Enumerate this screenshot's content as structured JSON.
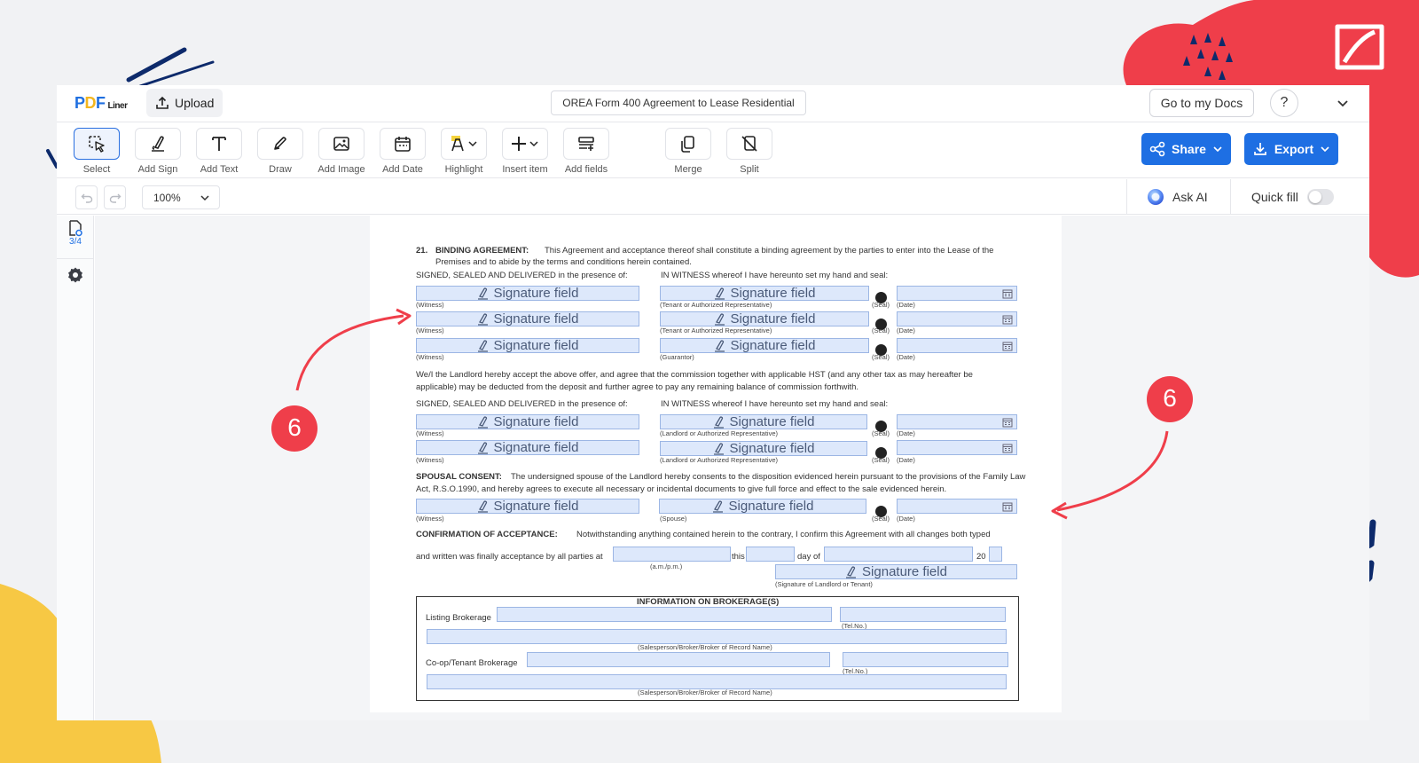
{
  "header": {
    "logo": {
      "p1": "P",
      "p2": "D",
      "p3": "F",
      "sub": "Liner"
    },
    "upload_label": "Upload",
    "doc_title": "OREA Form 400 Agreement to Lease Residential",
    "go_to_docs_label": "Go to my Docs",
    "help_label": "?"
  },
  "toolbar": {
    "tools": [
      {
        "label": "Select",
        "icon": "select-icon"
      },
      {
        "label": "Add Sign",
        "icon": "pen-sign-icon"
      },
      {
        "label": "Add Text",
        "icon": "text-icon"
      },
      {
        "label": "Draw",
        "icon": "draw-icon"
      },
      {
        "label": "Add Image",
        "icon": "image-icon"
      },
      {
        "label": "Add Date",
        "icon": "calendar-icon"
      },
      {
        "label": "Highlight",
        "icon": "highlight-icon"
      },
      {
        "label": "Insert item",
        "icon": "plus-icon"
      },
      {
        "label": "Add fields",
        "icon": "fields-icon"
      },
      {
        "label": "Merge",
        "icon": "merge-icon"
      },
      {
        "label": "Split",
        "icon": "split-icon"
      }
    ],
    "share_label": "Share",
    "export_label": "Export"
  },
  "subbar": {
    "zoom": "100%",
    "ask_ai_label": "Ask AI",
    "quick_fill_label": "Quick fill",
    "quick_fill_on": false
  },
  "sidebar": {
    "page_indicator": "3/4"
  },
  "colors": {
    "accent": "#1e6fe3",
    "field_fill": "#dde8fb",
    "annotation": "#ef3e4a",
    "deco_yellow": "#f7c844",
    "deco_navy": "#0d2a6b"
  },
  "annotations": {
    "left_badge": "6",
    "right_badge": "6"
  },
  "document": {
    "s21_num": "21.",
    "s21_title": "BINDING AGREEMENT:",
    "s21_text1": "This Agreement and acceptance thereof shall constitute a binding agreement by the parties to enter into the Lease of the",
    "s21_text2": "Premises and to abide by the terms and conditions herein contained.",
    "signed_sealed": "SIGNED, SEALED AND DELIVERED in the presence of:",
    "in_witness": "IN WITNESS whereof I have hereunto set my hand and seal:",
    "signature_field": "Signature field",
    "witness_label": "(Witness)",
    "tenant_rep_label": "(Tenant or Authorized Representative)",
    "guarantor_label": "(Guarantor)",
    "landlord_rep_label": "(Landlord or Authorized Representative)",
    "spouse_label": "(Spouse)",
    "seal_label": "(Seal)",
    "date_label": "(Date)",
    "landlord_text1": "We/I the Landlord hereby accept the above offer, and agree that the commission together with applicable HST (and any other tax as may hereafter be",
    "landlord_text2": "applicable) may be deducted from the deposit and further agree to pay any remaining balance of commission forthwith.",
    "spousal_title": "SPOUSAL CONSENT:",
    "spousal_text1": "The undersigned spouse of the Landlord hereby consents to the disposition evidenced herein pursuant to the provisions of the Family Law",
    "spousal_text2": "Act, R.S.O.1990, and hereby agrees to execute all necessary or incidental documents to give full force and effect to the sale evidenced herein.",
    "confirm_title": "CONFIRMATION OF ACCEPTANCE:",
    "confirm_text1": "Notwithstanding anything contained herein to the contrary, I confirm this Agreement with all changes both typed",
    "confirm_text2": "and written was finally acceptance by all parties at",
    "ampm_label": "(a.m./p.m.)",
    "this_label": "this",
    "day_of_label": "day of",
    "year_prefix": "20",
    "sig_landlord_tenant_label": "(Signature of Landlord or Tenant)",
    "brokerage_title": "INFORMATION ON BROKERAGE(S)",
    "listing_brokerage": "Listing Brokerage",
    "coop_brokerage": "Co-op/Tenant Brokerage",
    "tel_label": "(Tel.No.)",
    "salesperson_label": "(Salesperson/Broker/Broker of Record Name)"
  }
}
